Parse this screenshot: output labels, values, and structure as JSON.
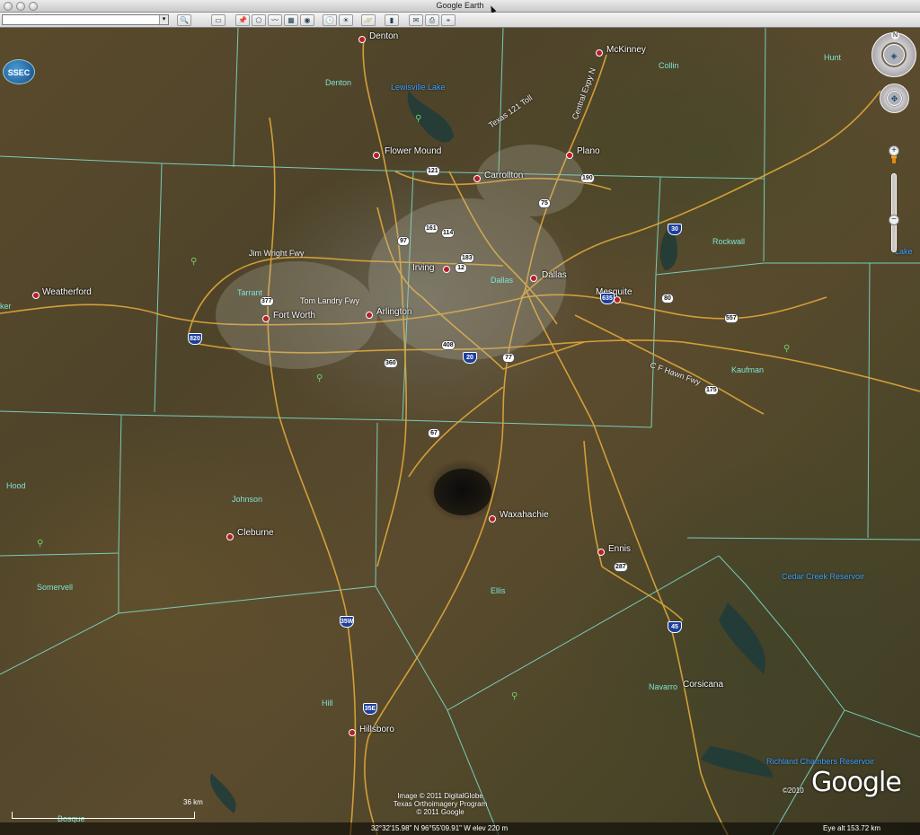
{
  "window": {
    "title": "Google Earth"
  },
  "toolbar": {
    "search_value": "",
    "buttons": [
      {
        "name": "search-icon",
        "glyph": "🔍"
      },
      {
        "name": "sidebar-icon",
        "glyph": "▭"
      },
      {
        "name": "placemark-icon",
        "glyph": "📌"
      },
      {
        "name": "polygon-icon",
        "glyph": "⬠"
      },
      {
        "name": "path-icon",
        "glyph": "〰"
      },
      {
        "name": "overlay-icon",
        "glyph": "▦"
      },
      {
        "name": "tour-icon",
        "glyph": "◉"
      },
      {
        "name": "history-icon",
        "glyph": "🕓"
      },
      {
        "name": "sun-icon",
        "glyph": "☀"
      },
      {
        "name": "planet-icon",
        "glyph": "🪐"
      },
      {
        "name": "ruler-icon",
        "glyph": "▮"
      },
      {
        "name": "email-icon",
        "glyph": "✉"
      },
      {
        "name": "print-icon",
        "glyph": "⎙"
      },
      {
        "name": "maps-icon",
        "glyph": "⌖"
      }
    ]
  },
  "cities": [
    {
      "id": "denton",
      "name": "Denton"
    },
    {
      "id": "mckinney",
      "name": "McKinney"
    },
    {
      "id": "flower-mound",
      "name": "Flower Mound"
    },
    {
      "id": "plano",
      "name": "Plano"
    },
    {
      "id": "carrollton",
      "name": "Carrollton"
    },
    {
      "id": "irving",
      "name": "Irving"
    },
    {
      "id": "dallas",
      "name": "Dallas"
    },
    {
      "id": "mesquite",
      "name": "Mesquite"
    },
    {
      "id": "weatherford",
      "name": "Weatherford"
    },
    {
      "id": "fort-worth",
      "name": "Fort Worth"
    },
    {
      "id": "arlington",
      "name": "Arlington"
    },
    {
      "id": "waxahachie",
      "name": "Waxahachie"
    },
    {
      "id": "cleburne",
      "name": "Cleburne"
    },
    {
      "id": "ennis",
      "name": "Ennis"
    },
    {
      "id": "corsicana",
      "name": "Corsicana"
    },
    {
      "id": "hillsboro",
      "name": "Hillsboro"
    }
  ],
  "counties": [
    {
      "id": "denton",
      "name": "Denton"
    },
    {
      "id": "collin",
      "name": "Collin"
    },
    {
      "id": "hunt",
      "name": "Hunt"
    },
    {
      "id": "rockwall",
      "name": "Rockwall"
    },
    {
      "id": "tarrant",
      "name": "Tarrant"
    },
    {
      "id": "dallas",
      "name": "Dallas"
    },
    {
      "id": "kaufman",
      "name": "Kaufman"
    },
    {
      "id": "parker",
      "name": "ker"
    },
    {
      "id": "hood",
      "name": "Hood"
    },
    {
      "id": "johnson",
      "name": "Johnson"
    },
    {
      "id": "somervell",
      "name": "Somervell"
    },
    {
      "id": "ellis",
      "name": "Ellis"
    },
    {
      "id": "navarro",
      "name": "Navarro"
    },
    {
      "id": "hill",
      "name": "Hill"
    },
    {
      "id": "bosque",
      "name": "Bosque"
    }
  ],
  "water": [
    {
      "id": "lewisville",
      "name": "Lewisville Lake"
    },
    {
      "id": "cedar-creek",
      "name": "Cedar Creek Reservoir"
    },
    {
      "id": "richland",
      "name": "Richland Chambers Reservoir"
    },
    {
      "id": "lake-edge",
      "name": "Lake"
    }
  ],
  "roads": [
    {
      "id": "texas-121-toll",
      "name": "Texas 121 Toll"
    },
    {
      "id": "central-expy",
      "name": "Central Expy N"
    },
    {
      "id": "jim-wright",
      "name": "Jim Wright Fwy"
    },
    {
      "id": "tom-landry",
      "name": "Tom Landry Fwy"
    },
    {
      "id": "c-hawn",
      "name": "C F Hawn Fwy"
    }
  ],
  "route_shields": [
    {
      "id": "121",
      "label": "121"
    },
    {
      "id": "190",
      "label": "190"
    },
    {
      "id": "75",
      "label": "75"
    },
    {
      "id": "161",
      "label": "161"
    },
    {
      "id": "114",
      "label": "114"
    },
    {
      "id": "97",
      "label": "97"
    },
    {
      "id": "183",
      "label": "183"
    },
    {
      "id": "12",
      "label": "12"
    },
    {
      "id": "80",
      "label": "80"
    },
    {
      "id": "557",
      "label": "557"
    },
    {
      "id": "377",
      "label": "377"
    },
    {
      "id": "408",
      "label": "408"
    },
    {
      "id": "360",
      "label": "360"
    },
    {
      "id": "77",
      "label": "77"
    },
    {
      "id": "175",
      "label": "175"
    },
    {
      "id": "67",
      "label": "67"
    },
    {
      "id": "287",
      "label": "287"
    }
  ],
  "interstate_shields": [
    {
      "id": "30",
      "label": "30"
    },
    {
      "id": "635",
      "label": "635"
    },
    {
      "id": "820",
      "label": "820"
    },
    {
      "id": "20",
      "label": "20"
    },
    {
      "id": "35w",
      "label": "35W"
    },
    {
      "id": "35e",
      "label": "35E"
    },
    {
      "id": "45",
      "label": "45"
    }
  ],
  "nav": {
    "north_label": "N",
    "zoom_in": "+",
    "zoom_out": "−",
    "logo_badge": "SSEC"
  },
  "attribution": {
    "line1": "Image © 2011 DigitalGlobe",
    "line2": "Texas Orthoimagery Program",
    "line3": "© 2011 Google"
  },
  "logo": {
    "text": "Google",
    "year": "©2010"
  },
  "status": {
    "coords": "32°32'15.98\" N  96°55'09.91\" W elev  220 m",
    "eye_alt": "Eye alt  153.72 km",
    "scale": "36 km"
  },
  "colors": {
    "road": "#e0a83a",
    "county_line": "#7fe3d2",
    "city_dot": "#b81d2a"
  }
}
